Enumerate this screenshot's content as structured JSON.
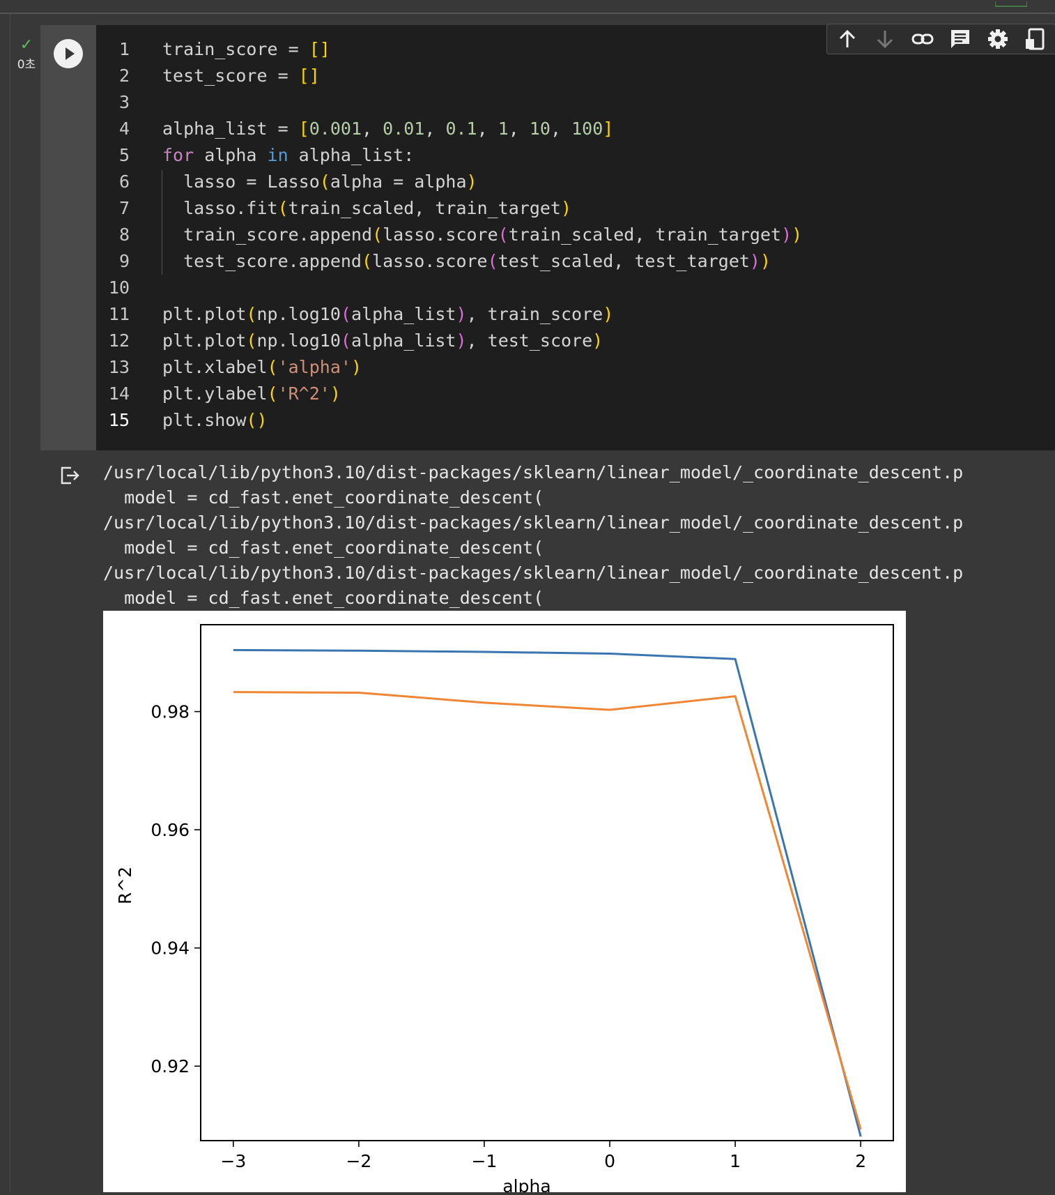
{
  "cell": {
    "exec_time": "0초",
    "code_lines": [
      "train_score = []",
      "test_score = []",
      "",
      "alpha_list = [0.001, 0.01, 0.1, 1, 10, 100]",
      "for alpha in alpha_list:",
      "  lasso = Lasso(alpha = alpha)",
      "  lasso.fit(train_scaled, train_target)",
      "  train_score.append(lasso.score(train_scaled, train_target))",
      "  test_score.append(lasso.score(test_scaled, test_target))",
      "",
      "plt.plot(np.log10(alpha_list), train_score)",
      "plt.plot(np.log10(alpha_list), test_score)",
      "plt.xlabel('alpha')",
      "plt.ylabel('R^2')",
      "plt.show()"
    ],
    "line_numbers": [
      "1",
      "2",
      "3",
      "4",
      "5",
      "6",
      "7",
      "8",
      "9",
      "10",
      "11",
      "12",
      "13",
      "14",
      "15"
    ]
  },
  "toolbar": {
    "icons": [
      "arrow-up-icon",
      "arrow-down-icon",
      "link-icon",
      "comment-icon",
      "gear-icon",
      "mirror-cell-icon"
    ]
  },
  "output": {
    "lines": [
      "/usr/local/lib/python3.10/dist-packages/sklearn/linear_model/_coordinate_descent.p",
      "  model = cd_fast.enet_coordinate_descent(",
      "/usr/local/lib/python3.10/dist-packages/sklearn/linear_model/_coordinate_descent.p",
      "  model = cd_fast.enet_coordinate_descent(",
      "/usr/local/lib/python3.10/dist-packages/sklearn/linear_model/_coordinate_descent.p",
      "  model = cd_fast.enet_coordinate_descent("
    ]
  },
  "chart_data": {
    "type": "line",
    "xlabel": "alpha",
    "ylabel": "R^2",
    "x": [
      -3,
      -2,
      -1,
      0,
      1,
      2
    ],
    "xticks": [
      "−3",
      "−2",
      "−1",
      "0",
      "1",
      "2"
    ],
    "yticks": [
      "0.92",
      "0.94",
      "0.96",
      "0.98"
    ],
    "ytick_values": [
      0.92,
      0.94,
      0.96,
      0.98
    ],
    "xlim": [
      -3.26,
      2.26
    ],
    "ylim": [
      0.9074,
      0.9947
    ],
    "grid": false,
    "series": [
      {
        "values": [
          0.9904,
          0.9903,
          0.9901,
          0.9898,
          0.9889,
          0.9081
        ],
        "color": "#3b75af"
      },
      {
        "values": [
          0.9833,
          0.9832,
          0.9815,
          0.9803,
          0.9826,
          0.9093
        ],
        "color": "#ef8636"
      }
    ]
  }
}
